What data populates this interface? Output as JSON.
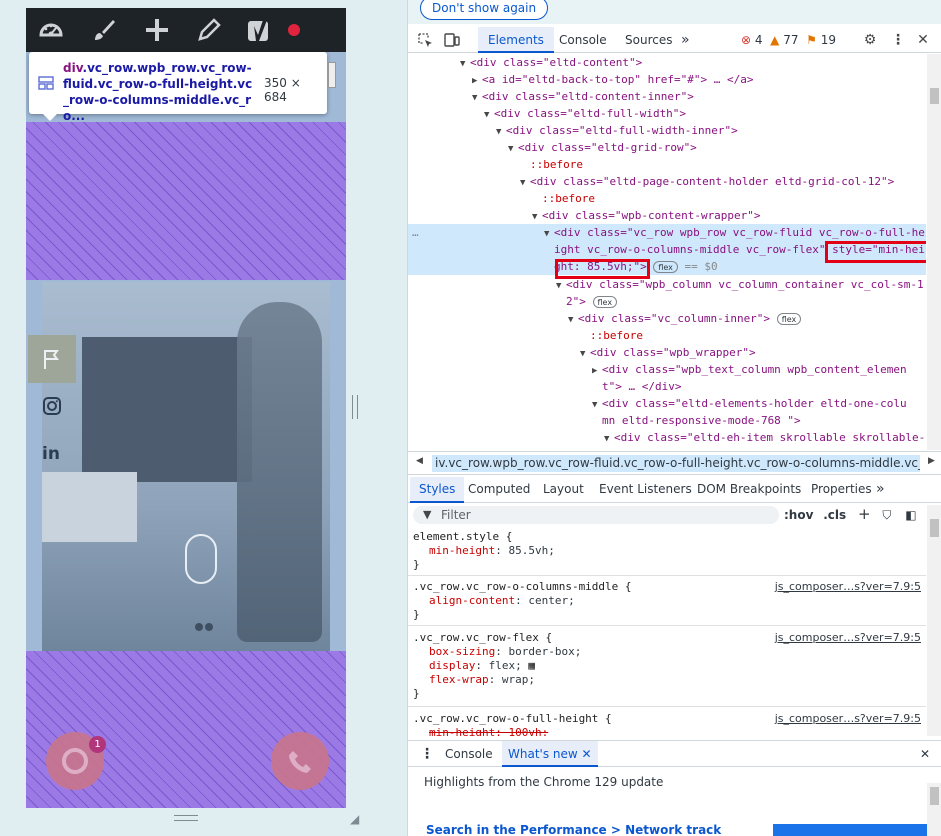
{
  "tooltip": {
    "selector_tag": "div",
    "selector_classes": ".vc_row.wpb_row.vc_row-fluid.vc_row-o-full-height.vc_row-o-columns-middle.vc_ro...",
    "size": "350 × 684"
  },
  "fabs": {
    "chat_badge": "1"
  },
  "devtools": {
    "dont_show_again": "Don't show again",
    "tabs": [
      "Elements",
      "Console",
      "Sources"
    ],
    "active_tab": "Elements",
    "more_tabs": "»",
    "errors": "4",
    "warnings": "77",
    "issues": "19"
  },
  "tree": [
    {
      "i": 0,
      "text": "<div class=\"eltd-content\">"
    },
    {
      "i": 1,
      "text": "<a id=\"eltd-back-to-top\" href=\"#\"> … </a>"
    },
    {
      "i": 2,
      "text": "<div class=\"eltd-content-inner\">"
    },
    {
      "i": 3,
      "text": "<div class=\"eltd-full-width\">"
    },
    {
      "i": 4,
      "text": "<div class=\"eltd-full-width-inner\">"
    },
    {
      "i": 5,
      "text": "<div class=\"eltd-grid-row\">"
    },
    {
      "i": 6,
      "text": "::before"
    },
    {
      "i": 7,
      "text": "<div class=\"eltd-page-content-holder eltd-grid-col-12\">"
    },
    {
      "i": 8,
      "text": "::before"
    },
    {
      "i": 9,
      "text": "<div class=\"wpb-content-wrapper\">"
    },
    {
      "i": 10,
      "text": "<div class=\"vc_row wpb_row vc_row-fluid vc_row-o-full-he"
    },
    {
      "i": 11,
      "text": "ight vc_row-o-columns-middle vc_row-flex\" style=\"min-hei"
    },
    {
      "i": 12,
      "text": "ght: 85.5vh;\">"
    },
    {
      "i": 13,
      "text": "flex"
    },
    {
      "i": 14,
      "text": "== $0"
    },
    {
      "i": 15,
      "text": "<div class=\"wpb_column vc_column_container vc_col-sm-1"
    },
    {
      "i": 16,
      "text": "2\">"
    },
    {
      "i": 17,
      "text": "<div class=\"vc_column-inner\">"
    },
    {
      "i": 18,
      "text": "::before"
    },
    {
      "i": 19,
      "text": "<div class=\"wpb_wrapper\">"
    },
    {
      "i": 20,
      "text": "<div class=\"wpb_text_column wpb_content_elemen"
    },
    {
      "i": 21,
      "text": "t\"> … </div>"
    },
    {
      "i": 22,
      "text": "<div class=\"eltd-elements-holder   eltd-one-colu"
    },
    {
      "i": 23,
      "text": "mn  eltd-responsive-mode-768 \">"
    },
    {
      "i": 24,
      "text": "<div class=\"eltd-eh-item skrollable skrollable-"
    }
  ],
  "breadcrumb": "iv.vc_row.wpb_row.vc_row-fluid.vc_row-o-full-height.vc_row-o-columns-middle.vc_row-flex",
  "style_tabs": [
    "Styles",
    "Computed",
    "Layout",
    "Event Listeners",
    "DOM Breakpoints",
    "Properties"
  ],
  "style_tabs_more": "»",
  "filter_placeholder": "Filter",
  "filter_tools": {
    "hov": ":hov",
    "cls": ".cls"
  },
  "rules": [
    {
      "selector": "element.style {",
      "source": "",
      "props": [
        {
          "n": "min-height",
          "v": "85.5vh;"
        }
      ]
    },
    {
      "selector": ".vc_row.vc_row-o-columns-middle {",
      "source": "js_composer…s?ver=7.9:5",
      "props": [
        {
          "n": "align-content",
          "v": "center;"
        }
      ]
    },
    {
      "selector": ".vc_row.vc_row-flex {",
      "source": "js_composer…s?ver=7.9:5",
      "props": [
        {
          "n": "box-sizing",
          "v": "border-box;"
        },
        {
          "n": "display",
          "v": "flex;"
        },
        {
          "n": "flex-wrap",
          "v": "wrap;"
        }
      ]
    },
    {
      "selector": ".vc_row.vc_row-o-full-height {",
      "source": "js_composer…s?ver=7.9:5",
      "props": [
        {
          "n": "min-height",
          "v": "100vh;"
        }
      ]
    }
  ],
  "close_brace": "}",
  "drawer": {
    "tabs": [
      "Console",
      "What's new"
    ],
    "active": "What's new",
    "highlights": "Highlights from the Chrome 129 update",
    "link": "Search in the Performance > Network track"
  }
}
